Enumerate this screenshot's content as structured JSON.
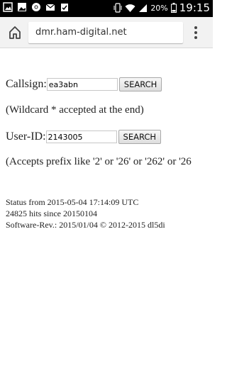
{
  "status_bar": {
    "battery_percent": "20%",
    "time": "19:15",
    "left_icons": [
      "image-icon",
      "photo-icon",
      "chrome-icon",
      "mail-icon",
      "clipboard-check-icon"
    ],
    "right_icons": [
      "vibrate-icon",
      "wifi-icon",
      "signal-icon",
      "battery-icon"
    ]
  },
  "browser": {
    "url": "dmr.ham-digital.net"
  },
  "form": {
    "callsign_label": "Callsign:",
    "callsign_value": "ea3abn",
    "search_label": "SEARCH",
    "wildcard_hint": "(Wildcard * accepted at the end)",
    "userid_label": "User-ID:",
    "userid_value": "2143005",
    "prefix_hint": "(Accepts prefix like '2' or '26' or '262' or '26"
  },
  "status": {
    "line1": "Status from 2015-05-04 17:14:09 UTC",
    "line2": "24825 hits since 20150104",
    "line3": "Software-Rev.: 2015/01/04 © 2012-2015 dl5di"
  }
}
